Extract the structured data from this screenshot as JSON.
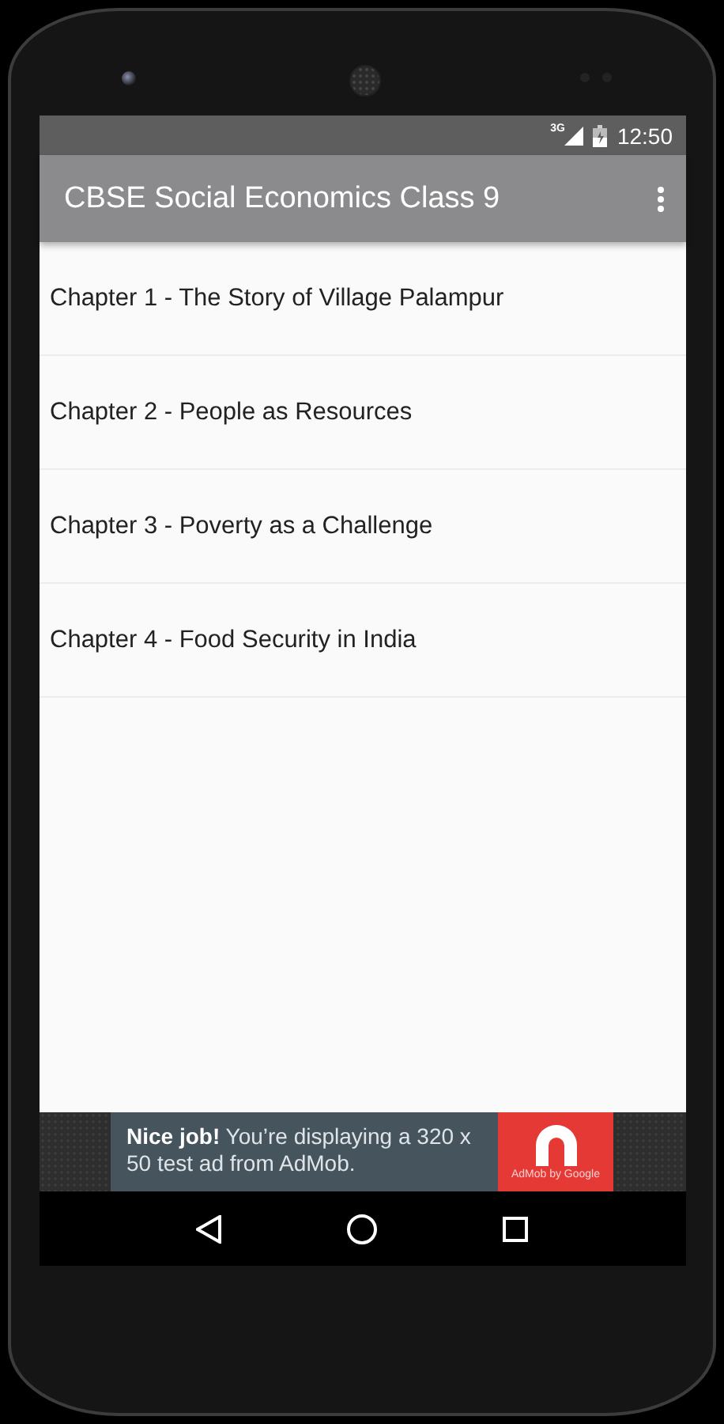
{
  "status_bar": {
    "network": "3G",
    "time": "12:50"
  },
  "app_bar": {
    "title": "CBSE Social Economics Class 9"
  },
  "chapters": [
    {
      "title": "Chapter 1 - The Story of Village Palampur"
    },
    {
      "title": "Chapter 2 - People as Resources"
    },
    {
      "title": "Chapter 3 - Poverty as a Challenge"
    },
    {
      "title": "Chapter 4 - Food Security in India"
    }
  ],
  "ad": {
    "text": "**Nice job!** You’re displaying a 320 x 50 test ad from AdMob.",
    "logo_caption": "AdMob by Google"
  }
}
